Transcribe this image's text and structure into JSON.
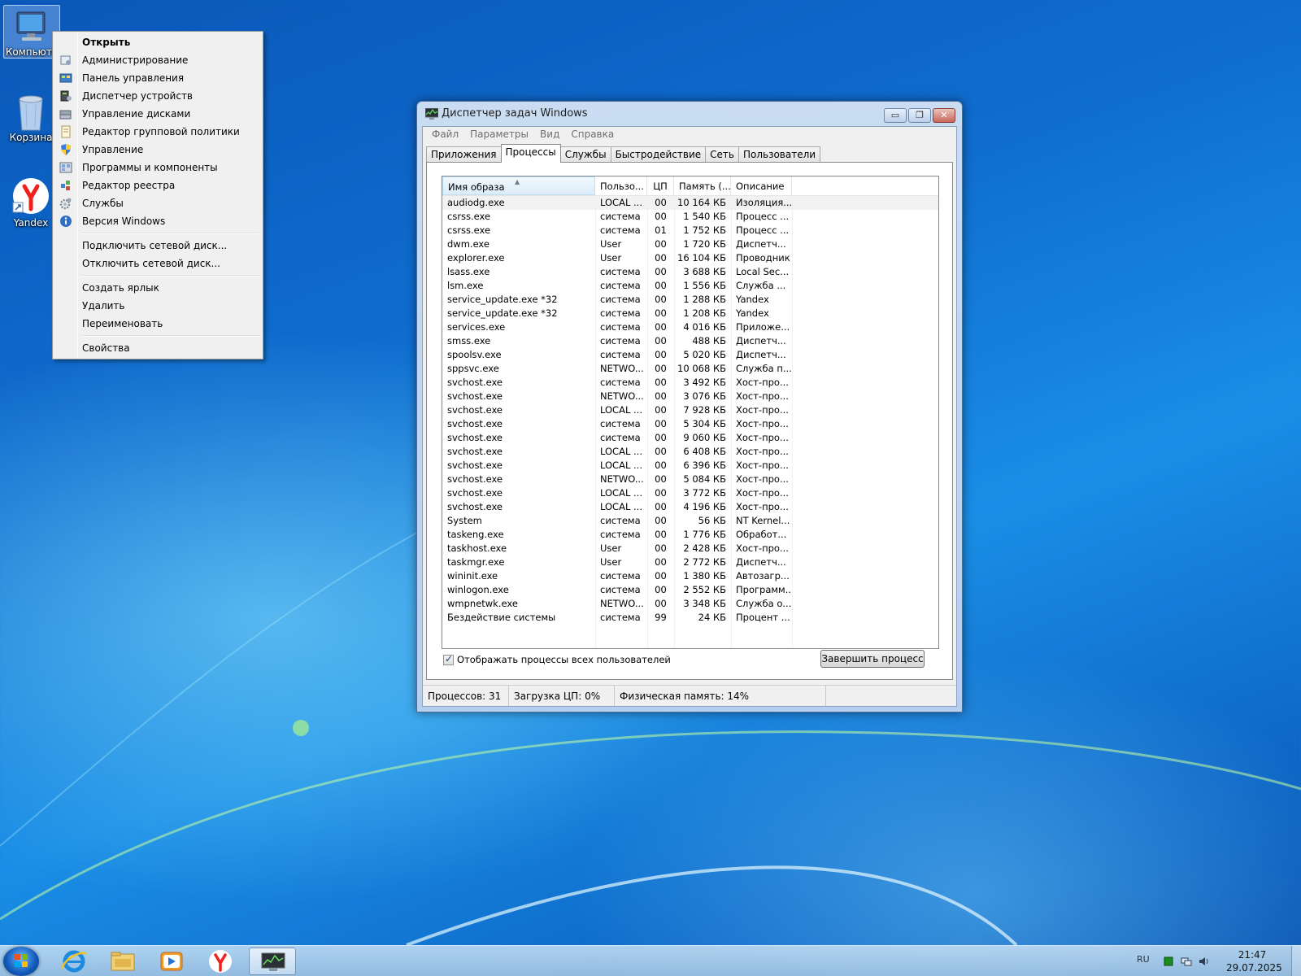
{
  "desktop": {
    "icons": [
      {
        "label": "Компьюте"
      },
      {
        "label": "Корзина"
      },
      {
        "label": "Yandex"
      }
    ]
  },
  "context_menu": {
    "items": [
      {
        "label": "Открыть",
        "icon": "none"
      },
      {
        "label": "Администрирование",
        "icon": "admin-icon"
      },
      {
        "label": "Панель управления",
        "icon": "control-panel-icon"
      },
      {
        "label": "Диспетчер устройств",
        "icon": "device-manager-icon"
      },
      {
        "label": "Управление дисками",
        "icon": "disk-management-icon"
      },
      {
        "label": "Редактор групповой политики",
        "icon": "group-policy-icon"
      },
      {
        "label": "Управление",
        "icon": "shield-icon"
      },
      {
        "label": "Программы и компоненты",
        "icon": "programs-icon"
      },
      {
        "label": "Редактор реестра",
        "icon": "registry-icon"
      },
      {
        "label": "Службы",
        "icon": "services-gear-icon"
      },
      {
        "label": "Версия Windows",
        "icon": "info-icon"
      },
      {
        "label": "Подключить сетевой диск..."
      },
      {
        "label": "Отключить сетевой диск..."
      },
      {
        "label": "Создать ярлык"
      },
      {
        "label": "Удалить"
      },
      {
        "label": "Переименовать"
      },
      {
        "label": "Свойства"
      }
    ]
  },
  "task_manager": {
    "title": "Диспетчер задач Windows",
    "menu": [
      "Файл",
      "Параметры",
      "Вид",
      "Справка"
    ],
    "tabs": [
      "Приложения",
      "Процессы",
      "Службы",
      "Быстродействие",
      "Сеть",
      "Пользователи"
    ],
    "active_tab": "Процессы",
    "columns": [
      "Имя образа",
      "Пользо...",
      "ЦП",
      "Память (...",
      "Описание"
    ],
    "rows": [
      [
        "audiodg.exe",
        "LOCAL ...",
        "00",
        "10 164 КБ",
        "Изоляция..."
      ],
      [
        "csrss.exe",
        "система",
        "00",
        "1 540 КБ",
        "Процесс ..."
      ],
      [
        "csrss.exe",
        "система",
        "01",
        "1 752 КБ",
        "Процесс ..."
      ],
      [
        "dwm.exe",
        "User",
        "00",
        "1 720 КБ",
        "Диспетч..."
      ],
      [
        "explorer.exe",
        "User",
        "00",
        "16 104 КБ",
        "Проводник"
      ],
      [
        "lsass.exe",
        "система",
        "00",
        "3 688 КБ",
        "Local Sec..."
      ],
      [
        "lsm.exe",
        "система",
        "00",
        "1 556 КБ",
        "Служба ..."
      ],
      [
        "service_update.exe *32",
        "система",
        "00",
        "1 288 КБ",
        "Yandex"
      ],
      [
        "service_update.exe *32",
        "система",
        "00",
        "1 208 КБ",
        "Yandex"
      ],
      [
        "services.exe",
        "система",
        "00",
        "4 016 КБ",
        "Приложе..."
      ],
      [
        "smss.exe",
        "система",
        "00",
        "488 КБ",
        "Диспетч..."
      ],
      [
        "spoolsv.exe",
        "система",
        "00",
        "5 020 КБ",
        "Диспетч..."
      ],
      [
        "sppsvc.exe",
        "NETWO...",
        "00",
        "10 068 КБ",
        "Служба п..."
      ],
      [
        "svchost.exe",
        "система",
        "00",
        "3 492 КБ",
        "Хост-про..."
      ],
      [
        "svchost.exe",
        "NETWO...",
        "00",
        "3 076 КБ",
        "Хост-про..."
      ],
      [
        "svchost.exe",
        "LOCAL ...",
        "00",
        "7 928 КБ",
        "Хост-про..."
      ],
      [
        "svchost.exe",
        "система",
        "00",
        "5 304 КБ",
        "Хост-про..."
      ],
      [
        "svchost.exe",
        "система",
        "00",
        "9 060 КБ",
        "Хост-про..."
      ],
      [
        "svchost.exe",
        "LOCAL ...",
        "00",
        "6 408 КБ",
        "Хост-про..."
      ],
      [
        "svchost.exe",
        "LOCAL ...",
        "00",
        "6 396 КБ",
        "Хост-про..."
      ],
      [
        "svchost.exe",
        "NETWO...",
        "00",
        "5 084 КБ",
        "Хост-про..."
      ],
      [
        "svchost.exe",
        "LOCAL ...",
        "00",
        "3 772 КБ",
        "Хост-про..."
      ],
      [
        "svchost.exe",
        "LOCAL ...",
        "00",
        "4 196 КБ",
        "Хост-про..."
      ],
      [
        "System",
        "система",
        "00",
        "56 КБ",
        "NT Kernel..."
      ],
      [
        "taskeng.exe",
        "система",
        "00",
        "1 776 КБ",
        "Обработ..."
      ],
      [
        "taskhost.exe",
        "User",
        "00",
        "2 428 КБ",
        "Хост-про..."
      ],
      [
        "taskmgr.exe",
        "User",
        "00",
        "2 772 КБ",
        "Диспетч..."
      ],
      [
        "wininit.exe",
        "система",
        "00",
        "1 380 КБ",
        "Автозагр..."
      ],
      [
        "winlogon.exe",
        "система",
        "00",
        "2 552 КБ",
        "Программ..."
      ],
      [
        "wmpnetwk.exe",
        "NETWO...",
        "00",
        "3 348 КБ",
        "Служба о..."
      ],
      [
        "Бездействие системы",
        "система",
        "99",
        "24 КБ",
        "Процент ..."
      ]
    ],
    "show_all_users_label": "Отображать процессы всех пользователей",
    "show_all_users_checked": true,
    "end_process_label": "Завершить процесс",
    "status": {
      "processes": "Процессов: 31",
      "cpu": "Загрузка ЦП: 0%",
      "memory": "Физическая память: 14%"
    }
  },
  "taskbar": {
    "apps": [
      "internet-explorer-icon",
      "file-explorer-icon",
      "media-player-icon",
      "yandex-browser-icon",
      "task-manager-icon"
    ],
    "language": "RU",
    "time": "21:47",
    "date": "29.07.2025"
  }
}
